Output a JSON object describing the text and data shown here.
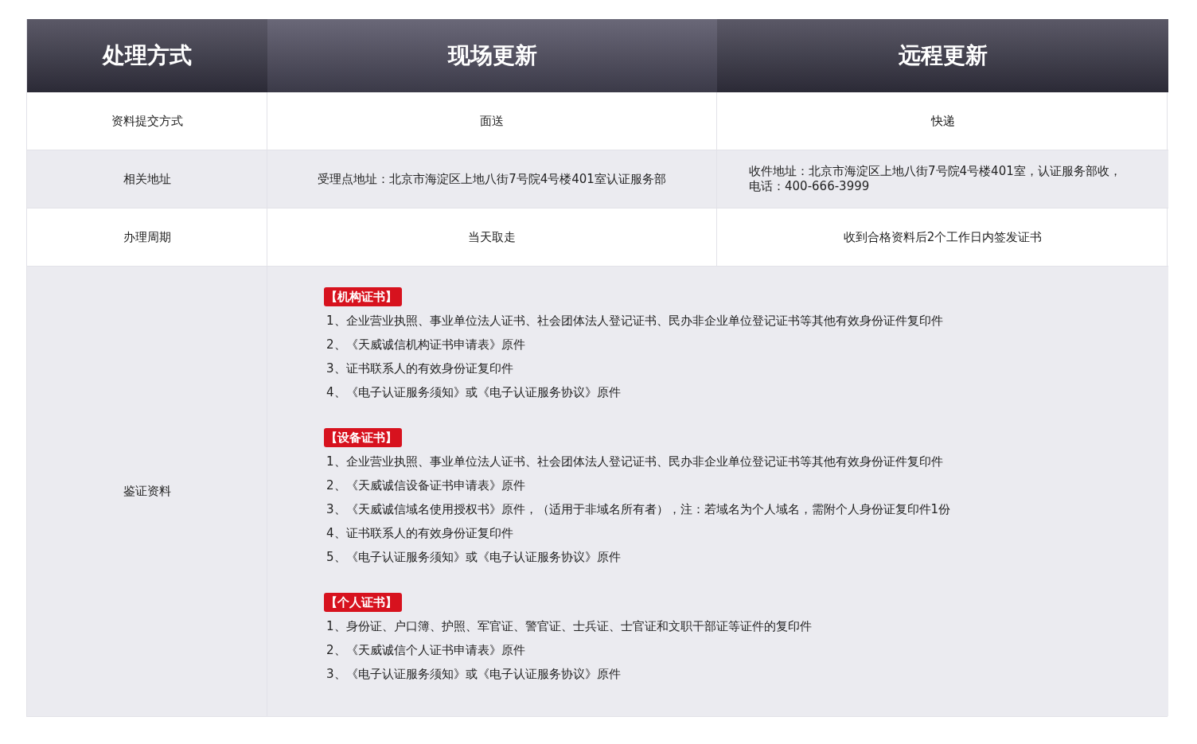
{
  "header": [
    {
      "label": "处理方式"
    },
    {
      "label": "现场更新"
    },
    {
      "label": "远程更新"
    }
  ],
  "rows": [
    {
      "label": "资料提交方式",
      "cells": [
        [
          "面送"
        ],
        [
          "快递"
        ]
      ]
    },
    {
      "label": "相关地址",
      "cells": [
        [
          "受理点地址：北京市海淀区上地八街7号院4号楼401室认证服务部"
        ],
        [
          "收件地址：北京市海淀区上地八街7号院4号楼401室，认证服务部收，",
          "电话：400-666-3999"
        ]
      ]
    },
    {
      "label": "办理周期",
      "cells": [
        [
          "当天取走"
        ],
        [
          "收到合格资料后2个工作日内签发证书"
        ]
      ]
    }
  ],
  "materials": {
    "label": "鉴证资料",
    "groups": [
      {
        "tag": "【机构证书】",
        "items": [
          "1、企业营业执照、事业单位法人证书、社会团体法人登记证书、民办非企业单位登记证书等其他有效身份证件复印件",
          "2、《天威诚信机构证书申请表》原件",
          "3、证书联系人的有效身份证复印件",
          "4、《电子认证服务须知》或《电子认证服务协议》原件"
        ]
      },
      {
        "tag": "【设备证书】",
        "items": [
          "1、企业营业执照、事业单位法人证书、社会团体法人登记证书、民办非企业单位登记证书等其他有效身份证件复印件",
          "2、《天威诚信设备证书申请表》原件",
          "3、《天威诚信域名使用授权书》原件，（适用于非域名所有者），注：若域名为个人域名，需附个人身份证复印件1份",
          "4、证书联系人的有效身份证复印件",
          "5、《电子认证服务须知》或《电子认证服务协议》原件"
        ]
      },
      {
        "tag": "【个人证书】",
        "items": [
          "1、身份证、户口簿、护照、军官证、警官证、士兵证、士官证和文职干部证等证件的复印件",
          "2、《天威诚信个人证书申请表》原件",
          "3、《电子认证服务须知》或《电子认证服务协议》原件"
        ]
      }
    ]
  }
}
